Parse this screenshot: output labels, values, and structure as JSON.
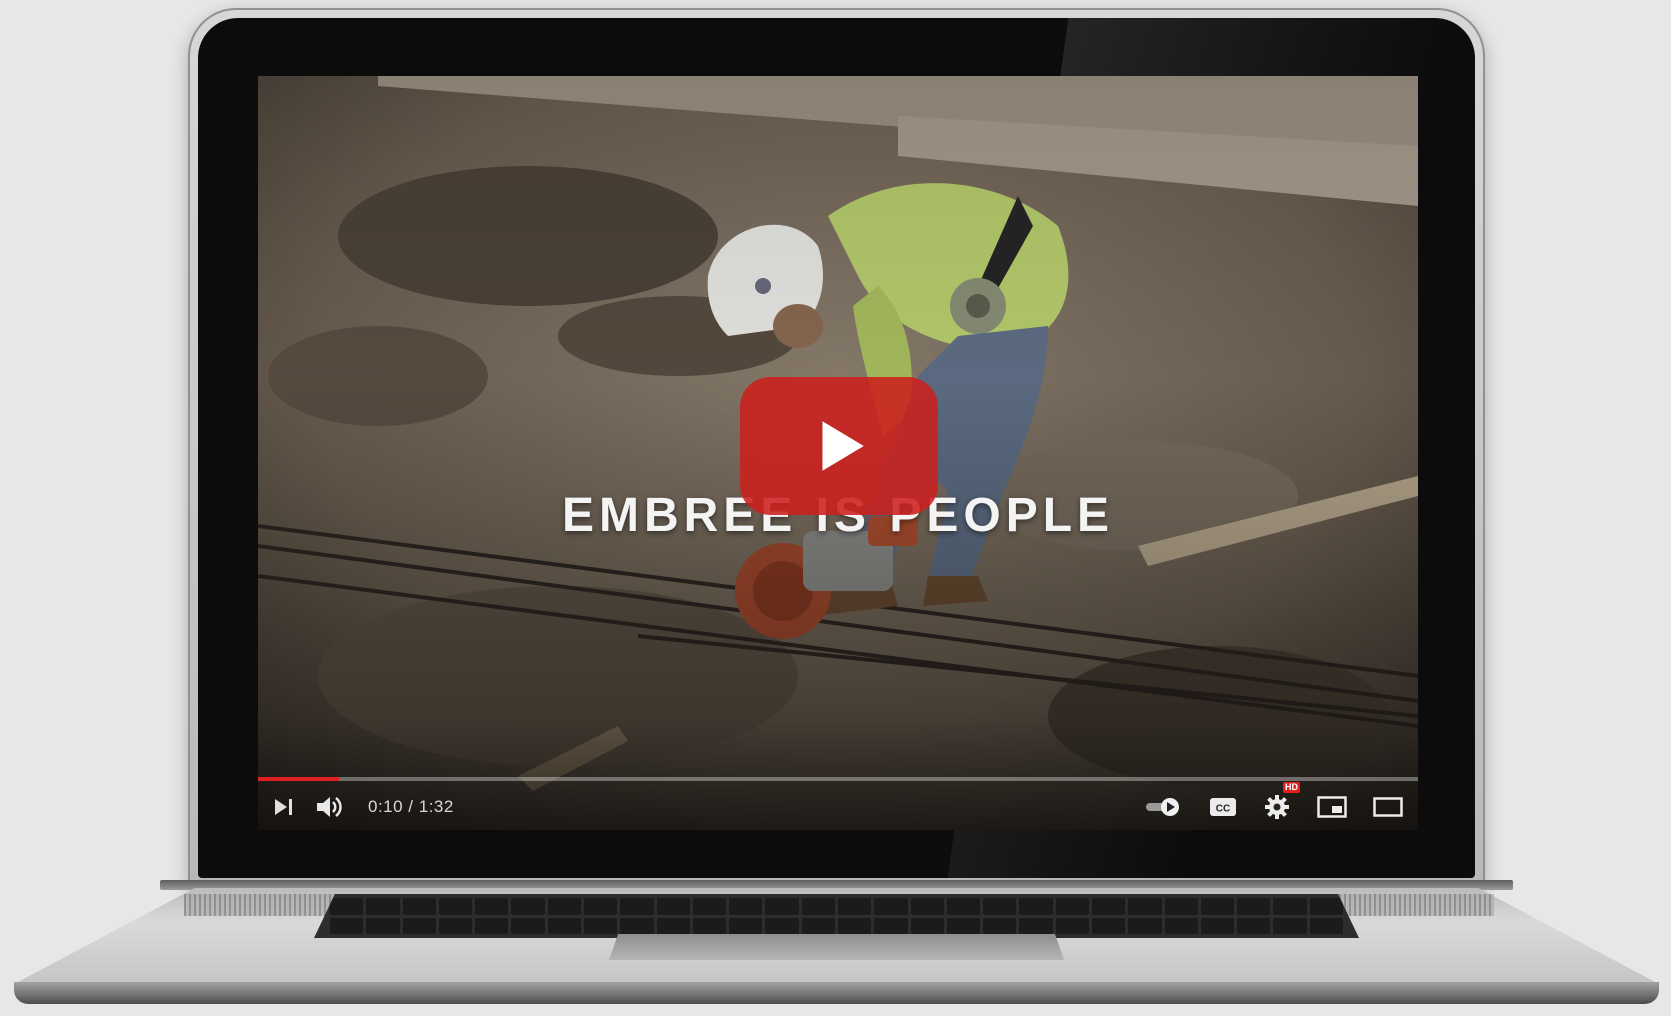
{
  "player": {
    "video_title": "EMBREE IS PEOPLE",
    "current_time": "0:10",
    "duration": "1:32",
    "time_display": "0:10 / 1:32",
    "progress_fraction": 0.07,
    "hd_badge": "HD",
    "cc_label": "CC",
    "accent_color": "#e02020",
    "play_button_color": "#cc201e"
  },
  "controls": {
    "left": [
      "next-icon",
      "volume-icon"
    ],
    "right": [
      "autoplay-toggle-icon",
      "captions-icon",
      "settings-icon",
      "miniplayer-icon",
      "theater-mode-icon"
    ]
  }
}
